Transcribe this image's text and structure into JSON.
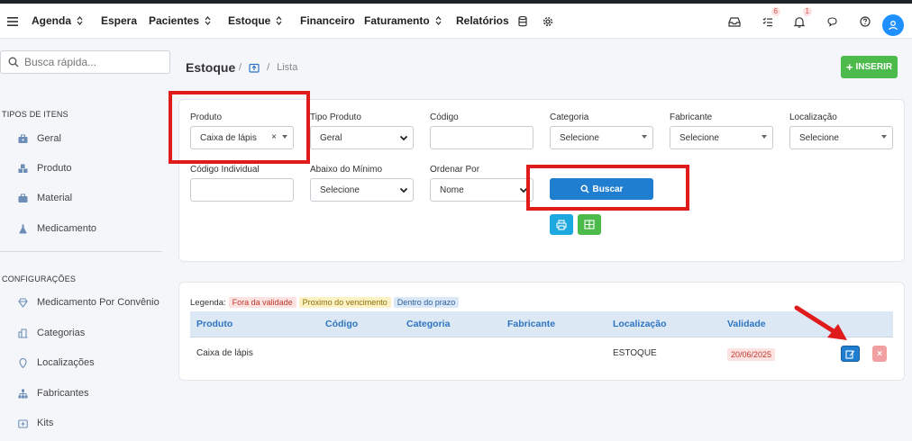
{
  "nav": {
    "items": [
      {
        "label": "Agenda",
        "dropdown": true
      },
      {
        "label": "Espera",
        "dropdown": false
      },
      {
        "label": "Pacientes",
        "dropdown": true
      },
      {
        "label": "Estoque",
        "dropdown": true
      },
      {
        "label": "Financeiro",
        "dropdown": false
      },
      {
        "label": "Faturamento",
        "dropdown": true
      },
      {
        "label": "Relatórios",
        "dropdown": false
      }
    ],
    "tasks_badge": "6",
    "notifications_badge": "1"
  },
  "sidebar": {
    "search_placeholder": "Busca rápida...",
    "section_items_title": "TIPOS DE ITENS",
    "items": [
      {
        "label": "Geral",
        "icon": "briefcase-icon"
      },
      {
        "label": "Produto",
        "icon": "cubes-icon"
      },
      {
        "label": "Material",
        "icon": "case-icon"
      },
      {
        "label": "Medicamento",
        "icon": "flask-icon"
      }
    ],
    "section_config_title": "CONFIGURAÇÕES",
    "config_items": [
      {
        "label": "Medicamento Por Convênio",
        "icon": "gem-icon"
      },
      {
        "label": "Categorias",
        "icon": "buildings-icon"
      },
      {
        "label": "Localizações",
        "icon": "map-pin-icon"
      },
      {
        "label": "Fabricantes",
        "icon": "sitemap-icon"
      },
      {
        "label": "Kits",
        "icon": "kit-box-icon"
      }
    ]
  },
  "header": {
    "title": "Estoque",
    "breadcrumb_current": "Lista",
    "insert_label": "INSERIR"
  },
  "filters": {
    "produto_label": "Produto",
    "produto_value": "Caixa de lápis",
    "tipo_label": "Tipo Produto",
    "tipo_value": "Geral",
    "codigo_label": "Código",
    "categoria_label": "Categoria",
    "categoria_value": "Selecione",
    "fabricante_label": "Fabricante",
    "fabricante_value": "Selecione",
    "localizacao_label": "Localização",
    "localizacao_value": "Selecione",
    "codigo_individual_label": "Código Individual",
    "abaixo_label": "Abaixo do Mínimo",
    "abaixo_value": "Selecione",
    "ordenar_label": "Ordenar Por",
    "ordenar_value": "Nome",
    "search_button": "Buscar"
  },
  "legend": {
    "label": "Legenda:",
    "expired": "Fora da validade",
    "near": "Proximo do vencimento",
    "ok": "Dentro do prazo",
    "colors": {
      "expired": "#fde2e2",
      "near": "#fdf2c4",
      "ok": "#dbe8f8"
    }
  },
  "table": {
    "columns": [
      "Produto",
      "Código",
      "Categoria",
      "Fabricante",
      "Localização",
      "Validade"
    ],
    "rows": [
      {
        "produto": "Caixa de lápis",
        "codigo": "",
        "categoria": "",
        "fabricante": "",
        "localizacao": "ESTOQUE",
        "validade": "20/06/2025"
      }
    ]
  }
}
